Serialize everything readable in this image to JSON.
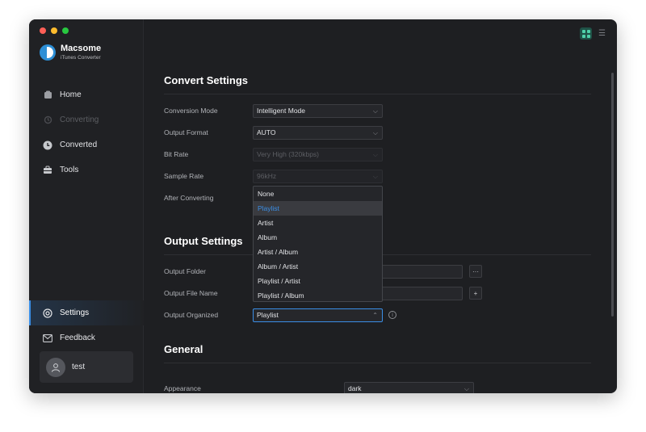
{
  "app": {
    "name": "Macsome",
    "subtitle": "iTunes Converter"
  },
  "colors": {
    "accent": "#3a8ee6",
    "traffic_red": "#ff5f57",
    "traffic_yellow": "#febc2e",
    "traffic_green": "#28c840",
    "toolbar_icon": "#4fd1a9"
  },
  "sidebar": {
    "items": [
      {
        "label": "Home",
        "icon": "home-icon",
        "state": "normal"
      },
      {
        "label": "Converting",
        "icon": "converting-icon",
        "state": "disabled"
      },
      {
        "label": "Converted",
        "icon": "clock-icon",
        "state": "normal"
      },
      {
        "label": "Tools",
        "icon": "toolbox-icon",
        "state": "normal"
      }
    ],
    "bottom_items": [
      {
        "label": "Settings",
        "icon": "gear-icon",
        "state": "active"
      },
      {
        "label": "Feedback",
        "icon": "mail-icon",
        "state": "normal"
      }
    ],
    "user": {
      "name": "test"
    }
  },
  "convert_settings": {
    "title": "Convert Settings",
    "conversion_mode": {
      "label": "Conversion Mode",
      "value": "Intelligent Mode"
    },
    "output_format": {
      "label": "Output Format",
      "value": "AUTO"
    },
    "bit_rate": {
      "label": "Bit Rate",
      "value": "Very High (320kbps)"
    },
    "sample_rate": {
      "label": "Sample Rate",
      "value": "96kHz"
    },
    "after_converting": {
      "label": "After Converting"
    }
  },
  "output_settings": {
    "title": "Output Settings",
    "output_folder": {
      "label": "Output Folder",
      "button": "···"
    },
    "output_file_name": {
      "label": "Output File Name",
      "button": "+"
    },
    "output_organized": {
      "label": "Output Organized",
      "value": "Playlist",
      "info": "i"
    }
  },
  "organized_dropdown": {
    "options": [
      "None",
      "Playlist",
      "Artist",
      "Album",
      "Artist / Album",
      "Album / Artist",
      "Playlist / Artist",
      "Playlist / Album"
    ],
    "selected": "Playlist"
  },
  "general": {
    "title": "General",
    "appearance": {
      "label": "Appearance",
      "value": "dark"
    }
  }
}
